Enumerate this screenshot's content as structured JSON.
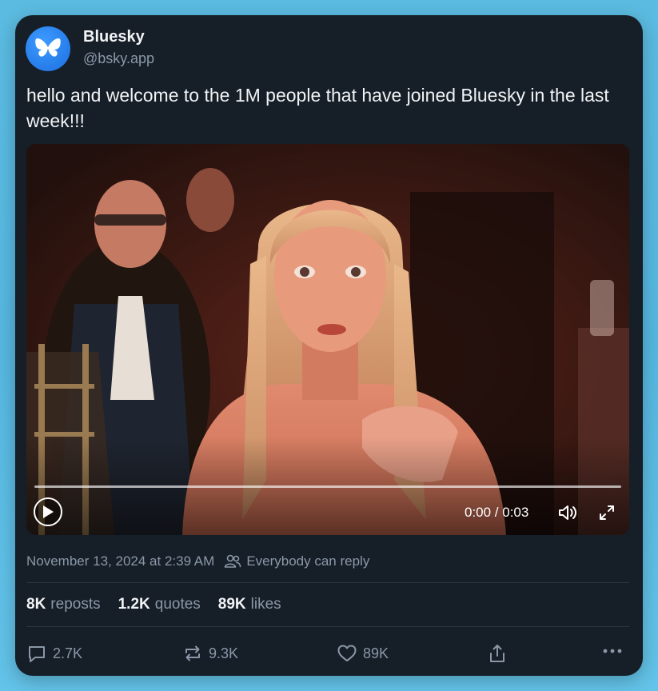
{
  "post": {
    "author_name": "Bluesky",
    "author_handle": "@bsky.app",
    "text": "hello and welcome to the 1M people that have joined Bluesky in the last week!!!",
    "timestamp": "November 13, 2024 at 2:39 AM",
    "reply_setting": "Everybody can reply"
  },
  "video": {
    "time_display": "0:00 / 0:03",
    "progress": 0
  },
  "stats": {
    "reposts_count": "8K",
    "reposts_label": "reposts",
    "quotes_count": "1.2K",
    "quotes_label": "quotes",
    "likes_count": "89K",
    "likes_label": "likes"
  },
  "actions": {
    "replies": "2.7K",
    "reposts": "9.3K",
    "likes": "89K"
  },
  "colors": {
    "page_bg": "#5bbbe0",
    "card_bg": "#161e27",
    "brand_blue": "#1c6fe0",
    "muted_text": "#8a98a8"
  },
  "icons": [
    "butterfly-logo-icon",
    "play-icon",
    "volume-icon",
    "fullscreen-icon",
    "people-icon",
    "reply-icon",
    "repost-icon",
    "like-icon",
    "share-icon",
    "more-icon"
  ]
}
